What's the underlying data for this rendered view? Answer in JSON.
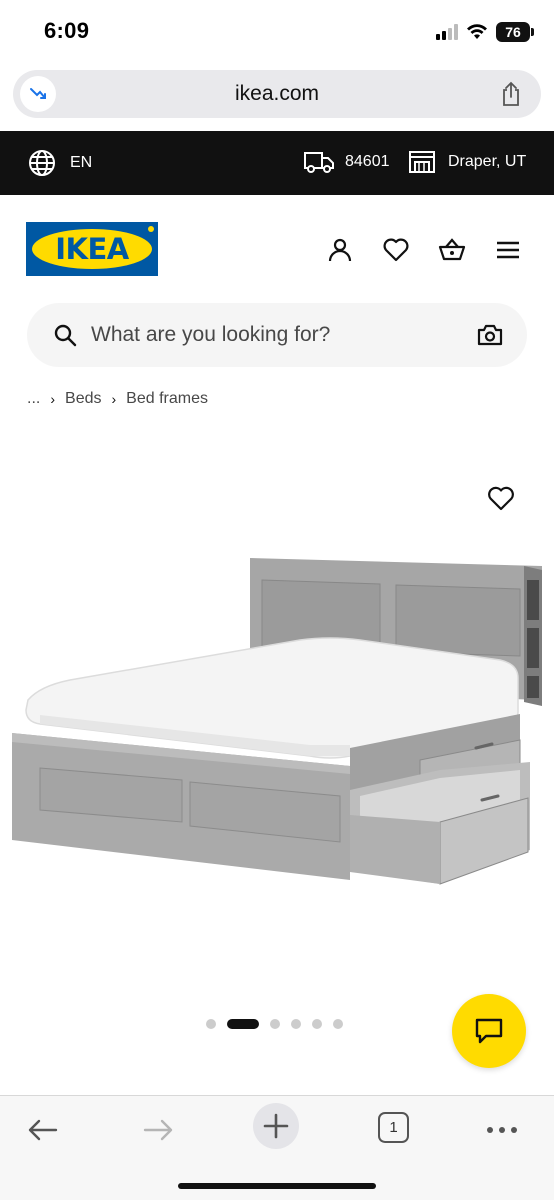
{
  "status_bar": {
    "time": "6:09",
    "battery": "76"
  },
  "browser": {
    "url": "ikea.com",
    "tab_count": "1"
  },
  "top_bar": {
    "language": "EN",
    "zip": "84601",
    "store": "Draper, UT"
  },
  "header": {
    "logo_text": "IKEA"
  },
  "search": {
    "placeholder": "What are you looking for?"
  },
  "breadcrumb": {
    "ellipsis": "...",
    "items": [
      "Beds",
      "Bed frames"
    ]
  },
  "gallery": {
    "image_count": 6,
    "active_index": 1
  },
  "colors": {
    "topbar": "#111111",
    "ikea_blue": "#0058a3",
    "ikea_yellow": "#ffdb00",
    "search_bg": "#f5f5f5"
  },
  "icons": [
    "globe-icon",
    "delivery-truck-icon",
    "store-icon",
    "user-icon",
    "heart-icon",
    "basket-icon",
    "menu-icon",
    "search-icon",
    "camera-icon",
    "chat-icon",
    "share-icon"
  ]
}
